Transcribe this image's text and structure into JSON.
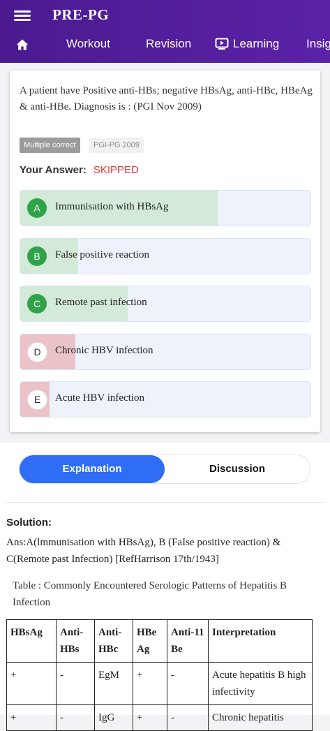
{
  "app": {
    "title": "PRE-PG"
  },
  "nav": {
    "items": [
      {
        "label": "Workout"
      },
      {
        "label": "Revision"
      },
      {
        "label": "Learning"
      },
      {
        "label": "Insig"
      }
    ]
  },
  "question": {
    "text": "A patient have Positive anti-HBs; negative HBsAg, anti-HBc, HBeAg & anti-HBe. Diagnosis is : (PGI Nov 2009)",
    "tags": [
      "Multiple correct",
      "PGI-PG 2009"
    ],
    "your_answer_label": "Your Answer:",
    "your_answer_value": "SKIPPED",
    "options": [
      {
        "letter": "A",
        "text": "Immunisation with HBsAg",
        "correct": true,
        "percent": 68
      },
      {
        "letter": "B",
        "text": "False positive reaction",
        "correct": true,
        "percent": 20
      },
      {
        "letter": "C",
        "text": "Remote past infection",
        "correct": true,
        "percent": 37
      },
      {
        "letter": "D",
        "text": "Chronic HBV infection",
        "correct": false,
        "percent": 19
      },
      {
        "letter": "E",
        "text": "Acute HBV infection",
        "correct": false,
        "percent": 10
      }
    ]
  },
  "tabs": {
    "explanation": "Explanation",
    "discussion": "Discussion"
  },
  "solution": {
    "label": "Solution:",
    "text": "Ans:A(lmmunisation with HBsAg), B (FaIse positive reaction) & C(Remote past Infection) [RefHarrison 17th/1943]",
    "table_caption": "Table : Commonly Encountered Serologic Patterns of Hepatitis B Infection",
    "table": {
      "headers": [
        "HBsAg",
        "Anti-HBs",
        "Anti-HBc",
        "HBe Ag",
        "Anti-11 Be",
        "Interpretation"
      ],
      "rows": [
        [
          "+",
          "-",
          "EgM",
          "+",
          "-",
          "Acute hepatitis B high infectivity"
        ],
        [
          "+",
          "-",
          "IgG",
          "+",
          "-",
          "Chronic hepatitis"
        ]
      ]
    }
  },
  "colors": {
    "header": "#4b1a8f",
    "correct_fill": "#d4ead9",
    "wrong_fill": "#eac2c8",
    "correct_circle": "#2fa24a",
    "accent": "#2f6df4",
    "skipped": "#e03a3a"
  }
}
